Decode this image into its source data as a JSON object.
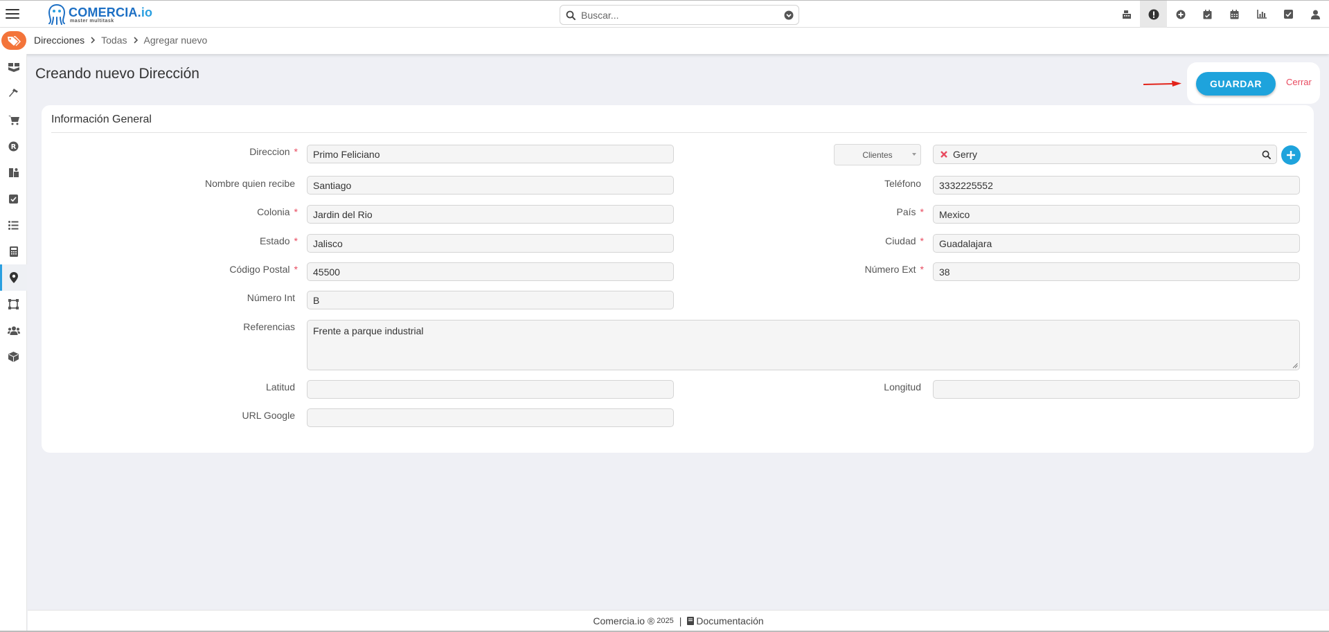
{
  "brand": {
    "name_main": "COMERCIA.",
    "name_suffix": "io",
    "tagline": "master multitask"
  },
  "search": {
    "placeholder": "Buscar..."
  },
  "topbar_icons": [
    "register-icon",
    "alert-icon",
    "add-circle-icon",
    "calendar-check-icon",
    "calendar-icon",
    "chart-icon",
    "check-square-icon",
    "user-icon"
  ],
  "breadcrumb": {
    "items": [
      "Direcciones",
      "Todas",
      "Agregar nuevo"
    ]
  },
  "sidebar_icons": [
    "boxes-icon",
    "hammer-icon",
    "cart-icon",
    "registered-icon",
    "supplies-icon",
    "check-square-icon",
    "list-icon",
    "calculator-icon",
    "map-marker-icon",
    "vector-square-icon",
    "users-icon",
    "cube-icon"
  ],
  "page": {
    "title": "Creando nuevo Dirección"
  },
  "actions": {
    "save_label": "GUARDAR",
    "close_label": "Cerrar"
  },
  "section": {
    "title": "Información General"
  },
  "form": {
    "direccion": {
      "label": "Direccion",
      "value": "Primo Feliciano",
      "required": "*"
    },
    "client_type": {
      "value": "Clientes"
    },
    "client": {
      "value": "Gerry"
    },
    "nombre": {
      "label": "Nombre quien recibe",
      "value": "Santiago"
    },
    "telefono": {
      "label": "Teléfono",
      "value": "3332225552"
    },
    "colonia": {
      "label": "Colonia",
      "value": "Jardin del Rio",
      "required": "*"
    },
    "pais": {
      "label": "País",
      "value": "Mexico",
      "required": "*"
    },
    "estado": {
      "label": "Estado",
      "value": "Jalisco",
      "required": "*"
    },
    "ciudad": {
      "label": "Ciudad",
      "value": "Guadalajara",
      "required": "*"
    },
    "cp": {
      "label": "Código Postal",
      "value": "45500",
      "required": "*"
    },
    "num_ext": {
      "label": "Número Ext",
      "value": "38",
      "required": "*"
    },
    "num_int": {
      "label": "Número Int",
      "value": "B"
    },
    "referencias": {
      "label": "Referencias",
      "value": "Frente a parque industrial"
    },
    "latitud": {
      "label": "Latitud",
      "value": ""
    },
    "longitud": {
      "label": "Longitud",
      "value": ""
    },
    "url_google": {
      "label": "URL Google",
      "value": ""
    }
  },
  "footer": {
    "brand": "Comercia.io ®",
    "year": "2025",
    "separator": "|",
    "doc_label": "Documentación"
  },
  "colors": {
    "accent": "#1ea3dc",
    "badge": "#f3743a",
    "required": "#e84a5f"
  }
}
